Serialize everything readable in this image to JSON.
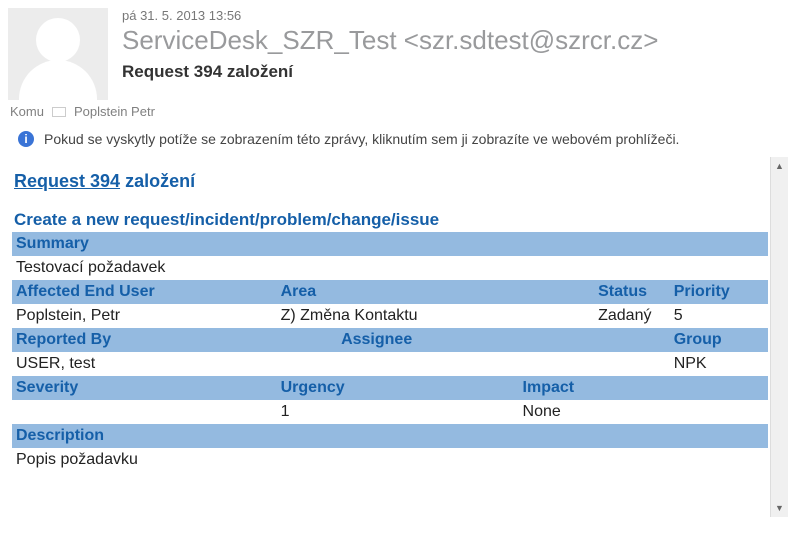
{
  "header": {
    "timestamp": "pá 31. 5. 2013 13:56",
    "sender": "ServiceDesk_SZR_Test <szr.sdtest@szrcr.cz>",
    "subject": "Request 394 založení"
  },
  "recipients": {
    "label": "Komu",
    "value": "Poplstein Petr"
  },
  "info_bar": {
    "text": "Pokud se vyskytly potíže se zobrazením této zprávy, kliknutím sem ji zobrazíte ve webovém prohlížeči."
  },
  "body": {
    "title_link": "Request 394",
    "title_rest": " založení",
    "section_heading": "Create a new request/incident/problem/change/issue",
    "labels": {
      "summary": "Summary",
      "affected_end_user": "Affected End User",
      "area": "Area",
      "status": "Status",
      "priority": "Priority",
      "reported_by": "Reported By",
      "assignee": "Assignee",
      "group": "Group",
      "severity": "Severity",
      "urgency": "Urgency",
      "impact": "Impact",
      "description": "Description"
    },
    "values": {
      "summary": "Testovací požadavek",
      "affected_end_user": "Poplstein, Petr",
      "area": " Z) Změna Kontaktu",
      "status": "Zadaný",
      "priority": "5",
      "reported_by": "USER, test",
      "assignee": "",
      "group": "NPK",
      "severity": "",
      "urgency": "1",
      "impact": "None",
      "description": "Popis požadavku"
    }
  }
}
